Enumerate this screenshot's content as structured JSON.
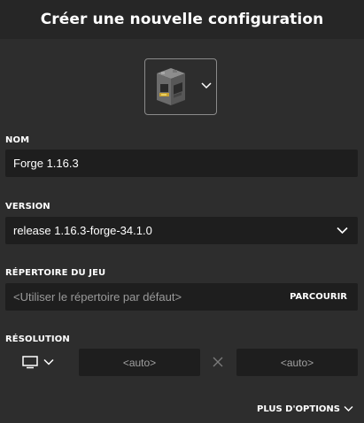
{
  "header": {
    "title": "Créer une nouvelle configuration"
  },
  "icon_picker": {
    "icon": "furnace-block-icon",
    "dropdown_icon": "chevron-down-icon"
  },
  "name_field": {
    "label": "NOM",
    "value": "Forge 1.16.3"
  },
  "version_field": {
    "label": "VERSION",
    "value": "release 1.16.3-forge-34.1.0",
    "dropdown_icon": "chevron-down-icon"
  },
  "game_directory": {
    "label": "RÉPERTOIRE DU JEU",
    "placeholder": "<Utiliser le répertoire par défaut>",
    "browse_label": "PARCOURIR"
  },
  "resolution": {
    "label": "RÉSOLUTION",
    "display_icon": "monitor-icon",
    "width_value": "<auto>",
    "height_value": "<auto>",
    "separator_icon": "times-icon"
  },
  "more_options": {
    "label": "PLUS D'OPTIONS",
    "icon": "chevron-down-icon"
  },
  "colors": {
    "background": "#2d2d2d",
    "header": "#262626",
    "field": "#1e1e1e",
    "muted_text": "#9a9a9a"
  }
}
